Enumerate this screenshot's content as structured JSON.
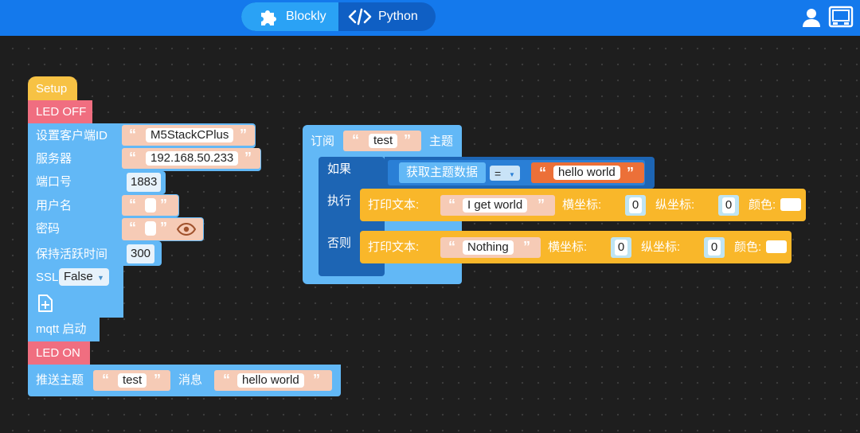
{
  "header": {
    "modes": [
      {
        "label": "Blockly",
        "icon": "puzzle-icon",
        "active": true
      },
      {
        "label": "Python",
        "icon": "code-icon",
        "active": false
      }
    ],
    "icons": [
      "user-icon",
      "device-icon"
    ],
    "colors": {
      "bar": "#1479ec",
      "active_tab": "#2aa2f5"
    }
  },
  "setup_stack": {
    "setup": "Setup",
    "led_off": "LED OFF",
    "mqtt_config": {
      "client_id_label": "设置客户端ID",
      "client_id": "M5StackCPlus",
      "server_label": "服务器",
      "server": "192.168.50.233",
      "port_label": "端口号",
      "port": "1883",
      "user_label": "用户名",
      "user": "",
      "password_label": "密码",
      "password": "",
      "keepalive_label": "保持活跃时间",
      "keepalive": "300",
      "ssl_label": "SSL",
      "ssl_value": "False"
    },
    "mqtt_start": "mqtt 启动",
    "led_on": "LED ON",
    "publish": {
      "label": "推送主题",
      "topic": "test",
      "msg_label": "消息",
      "message": "hello world"
    }
  },
  "subscribe_block": {
    "label": "订阅",
    "topic": "test",
    "topic_label": "主题",
    "if_label": "如果",
    "get_topic_data": "获取主题数据",
    "operator": "=",
    "compare": "hello world",
    "then_label": "执行",
    "else_label": "否则",
    "print_then": {
      "label": "打印文本:",
      "text": "I get world",
      "x_label": "横坐标:",
      "x": "0",
      "y_label": "纵坐标:",
      "y": "0",
      "color_label": "颜色:"
    },
    "print_else": {
      "label": "打印文本:",
      "text": "Nothing",
      "x_label": "横坐标:",
      "x": "0",
      "y_label": "纵坐标:",
      "y": "0",
      "color_label": "颜色:"
    }
  }
}
